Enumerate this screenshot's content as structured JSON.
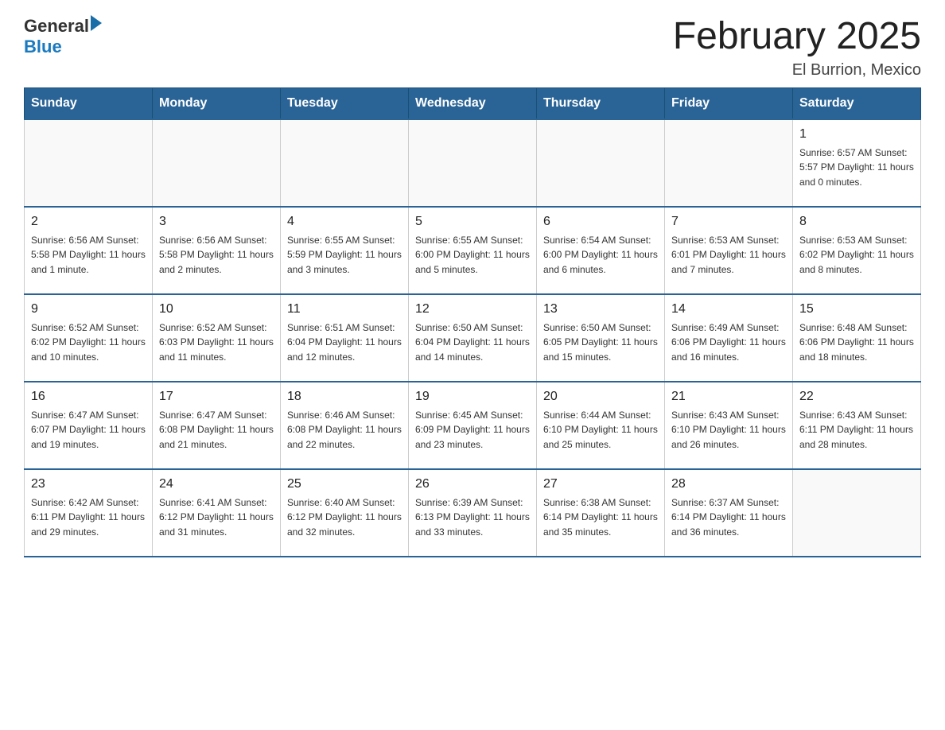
{
  "header": {
    "logo_general": "General",
    "logo_blue": "Blue",
    "month_title": "February 2025",
    "location": "El Burrion, Mexico"
  },
  "weekdays": [
    "Sunday",
    "Monday",
    "Tuesday",
    "Wednesday",
    "Thursday",
    "Friday",
    "Saturday"
  ],
  "weeks": [
    [
      {
        "day": "",
        "info": ""
      },
      {
        "day": "",
        "info": ""
      },
      {
        "day": "",
        "info": ""
      },
      {
        "day": "",
        "info": ""
      },
      {
        "day": "",
        "info": ""
      },
      {
        "day": "",
        "info": ""
      },
      {
        "day": "1",
        "info": "Sunrise: 6:57 AM\nSunset: 5:57 PM\nDaylight: 11 hours and 0 minutes."
      }
    ],
    [
      {
        "day": "2",
        "info": "Sunrise: 6:56 AM\nSunset: 5:58 PM\nDaylight: 11 hours and 1 minute."
      },
      {
        "day": "3",
        "info": "Sunrise: 6:56 AM\nSunset: 5:58 PM\nDaylight: 11 hours and 2 minutes."
      },
      {
        "day": "4",
        "info": "Sunrise: 6:55 AM\nSunset: 5:59 PM\nDaylight: 11 hours and 3 minutes."
      },
      {
        "day": "5",
        "info": "Sunrise: 6:55 AM\nSunset: 6:00 PM\nDaylight: 11 hours and 5 minutes."
      },
      {
        "day": "6",
        "info": "Sunrise: 6:54 AM\nSunset: 6:00 PM\nDaylight: 11 hours and 6 minutes."
      },
      {
        "day": "7",
        "info": "Sunrise: 6:53 AM\nSunset: 6:01 PM\nDaylight: 11 hours and 7 minutes."
      },
      {
        "day": "8",
        "info": "Sunrise: 6:53 AM\nSunset: 6:02 PM\nDaylight: 11 hours and 8 minutes."
      }
    ],
    [
      {
        "day": "9",
        "info": "Sunrise: 6:52 AM\nSunset: 6:02 PM\nDaylight: 11 hours and 10 minutes."
      },
      {
        "day": "10",
        "info": "Sunrise: 6:52 AM\nSunset: 6:03 PM\nDaylight: 11 hours and 11 minutes."
      },
      {
        "day": "11",
        "info": "Sunrise: 6:51 AM\nSunset: 6:04 PM\nDaylight: 11 hours and 12 minutes."
      },
      {
        "day": "12",
        "info": "Sunrise: 6:50 AM\nSunset: 6:04 PM\nDaylight: 11 hours and 14 minutes."
      },
      {
        "day": "13",
        "info": "Sunrise: 6:50 AM\nSunset: 6:05 PM\nDaylight: 11 hours and 15 minutes."
      },
      {
        "day": "14",
        "info": "Sunrise: 6:49 AM\nSunset: 6:06 PM\nDaylight: 11 hours and 16 minutes."
      },
      {
        "day": "15",
        "info": "Sunrise: 6:48 AM\nSunset: 6:06 PM\nDaylight: 11 hours and 18 minutes."
      }
    ],
    [
      {
        "day": "16",
        "info": "Sunrise: 6:47 AM\nSunset: 6:07 PM\nDaylight: 11 hours and 19 minutes."
      },
      {
        "day": "17",
        "info": "Sunrise: 6:47 AM\nSunset: 6:08 PM\nDaylight: 11 hours and 21 minutes."
      },
      {
        "day": "18",
        "info": "Sunrise: 6:46 AM\nSunset: 6:08 PM\nDaylight: 11 hours and 22 minutes."
      },
      {
        "day": "19",
        "info": "Sunrise: 6:45 AM\nSunset: 6:09 PM\nDaylight: 11 hours and 23 minutes."
      },
      {
        "day": "20",
        "info": "Sunrise: 6:44 AM\nSunset: 6:10 PM\nDaylight: 11 hours and 25 minutes."
      },
      {
        "day": "21",
        "info": "Sunrise: 6:43 AM\nSunset: 6:10 PM\nDaylight: 11 hours and 26 minutes."
      },
      {
        "day": "22",
        "info": "Sunrise: 6:43 AM\nSunset: 6:11 PM\nDaylight: 11 hours and 28 minutes."
      }
    ],
    [
      {
        "day": "23",
        "info": "Sunrise: 6:42 AM\nSunset: 6:11 PM\nDaylight: 11 hours and 29 minutes."
      },
      {
        "day": "24",
        "info": "Sunrise: 6:41 AM\nSunset: 6:12 PM\nDaylight: 11 hours and 31 minutes."
      },
      {
        "day": "25",
        "info": "Sunrise: 6:40 AM\nSunset: 6:12 PM\nDaylight: 11 hours and 32 minutes."
      },
      {
        "day": "26",
        "info": "Sunrise: 6:39 AM\nSunset: 6:13 PM\nDaylight: 11 hours and 33 minutes."
      },
      {
        "day": "27",
        "info": "Sunrise: 6:38 AM\nSunset: 6:14 PM\nDaylight: 11 hours and 35 minutes."
      },
      {
        "day": "28",
        "info": "Sunrise: 6:37 AM\nSunset: 6:14 PM\nDaylight: 11 hours and 36 minutes."
      },
      {
        "day": "",
        "info": ""
      }
    ]
  ]
}
